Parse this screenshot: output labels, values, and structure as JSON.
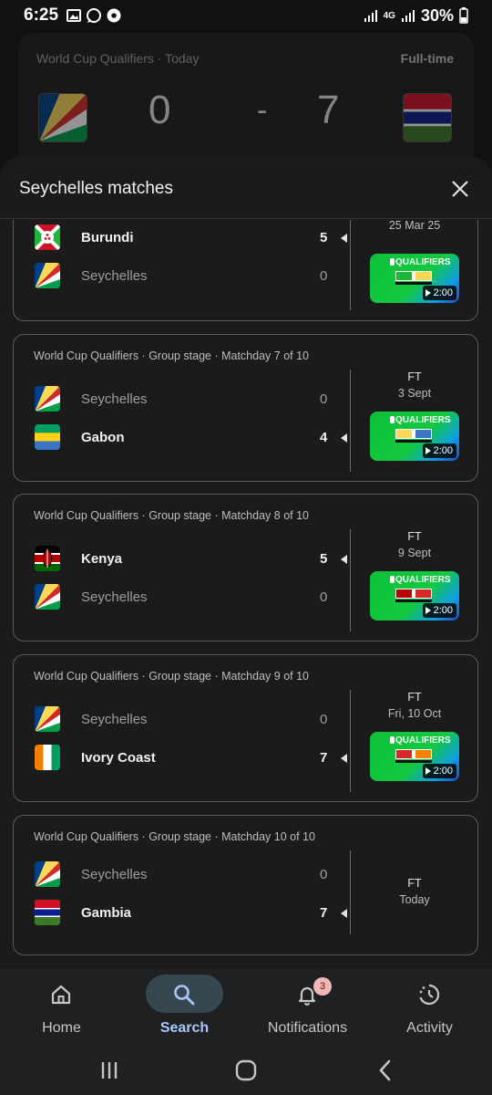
{
  "status_bar": {
    "time": "6:25",
    "battery": "30%",
    "network": "4G"
  },
  "background_card": {
    "competition": "World Cup Qualifiers · Today",
    "status": "Full-time",
    "home_score": "0",
    "separator": "-",
    "away_score": "7"
  },
  "sheet": {
    "title": "Seychelles matches"
  },
  "matches": [
    {
      "competition": "",
      "home": {
        "name": "Burundi",
        "score": "5",
        "winner": true
      },
      "away": {
        "name": "Seychelles",
        "score": "0",
        "winner": false
      },
      "status": "",
      "date": "25 Mar 25",
      "video_duration": "2:00"
    },
    {
      "competition": "World Cup Qualifiers · Group stage · Matchday 7 of 10",
      "home": {
        "name": "Seychelles",
        "score": "0",
        "winner": false
      },
      "away": {
        "name": "Gabon",
        "score": "4",
        "winner": true
      },
      "status": "FT",
      "date": "3 Sept",
      "video_duration": "2:00"
    },
    {
      "competition": "World Cup Qualifiers · Group stage · Matchday 8 of 10",
      "home": {
        "name": "Kenya",
        "score": "5",
        "winner": true
      },
      "away": {
        "name": "Seychelles",
        "score": "0",
        "winner": false
      },
      "status": "FT",
      "date": "9 Sept",
      "video_duration": "2:00"
    },
    {
      "competition": "World Cup Qualifiers · Group stage · Matchday 9 of 10",
      "home": {
        "name": "Seychelles",
        "score": "0",
        "winner": false
      },
      "away": {
        "name": "Ivory Coast",
        "score": "7",
        "winner": true
      },
      "status": "FT",
      "date": "Fri, 10 Oct",
      "video_duration": "2:00"
    },
    {
      "competition": "World Cup Qualifiers · Group stage · Matchday 10 of 10",
      "home": {
        "name": "Seychelles",
        "score": "0",
        "winner": false
      },
      "away": {
        "name": "Gambia",
        "score": "7",
        "winner": true
      },
      "status": "FT",
      "date": "Today"
    }
  ],
  "video_thumb": {
    "brand": "QUALIFIERS"
  },
  "bottom_nav": {
    "items": [
      {
        "label": "Home",
        "icon": "home-icon"
      },
      {
        "label": "Search",
        "icon": "search-icon",
        "active": true
      },
      {
        "label": "Notifications",
        "icon": "bell-icon",
        "badge": "3"
      },
      {
        "label": "Activity",
        "icon": "activity-icon"
      }
    ]
  },
  "colors": {
    "accent": "#a8c7fa",
    "active_pill": "#37474f",
    "badge": "#f2b8b5",
    "sheet_bg": "#1b1b1b"
  }
}
